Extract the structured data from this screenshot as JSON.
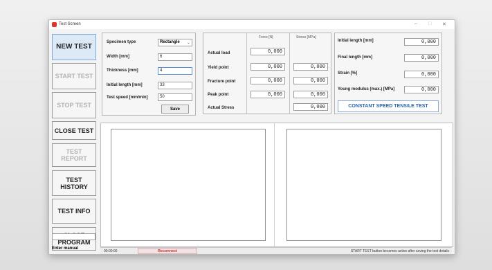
{
  "window": {
    "title": "Test Screen",
    "minimize": "–",
    "maximize": "□",
    "close": "✕"
  },
  "sidebar": {
    "new_test": "NEW TEST",
    "start_test": "START TEST",
    "stop_test": "STOP TEST",
    "close_test": "CLOSE TEST",
    "test_report": "TEST REPORT",
    "test_history": "TEST HISTORY",
    "test_info": "TEST INFO",
    "close_program": "CLOSE PROGRAM",
    "manual_value": "",
    "enter_manual": "Enter manual"
  },
  "specimen": {
    "type_label": "Specimen type",
    "type_value": "Rectangle",
    "width_label": "Width [mm]",
    "width_value": "6",
    "thickness_label": "Thickness [mm]",
    "thickness_value": "4",
    "initial_length_label": "Initial length [mm]",
    "initial_length_value": "33",
    "speed_label": "Test speed [mm/min]",
    "speed_value": "50",
    "save_label": "Save"
  },
  "results": {
    "force_header": "Force [N]",
    "stress_header": "Stress [MPa]",
    "actual_load_label": "Actual load",
    "actual_load_force": "0,000",
    "yield_label": "Yield point",
    "yield_force": "0,000",
    "yield_stress": "0,000",
    "fracture_label": "Fracture point",
    "fracture_force": "0,000",
    "fracture_stress": "0,000",
    "peak_label": "Peak point",
    "peak_force": "0,000",
    "peak_stress": "0,000",
    "actual_stress_label": "Actual Stress",
    "actual_stress_value": "0,000"
  },
  "lengths": {
    "initial_length_label": "Initial length [mm]",
    "initial_length_value": "0,000",
    "final_length_label": "Final length [mm]",
    "final_length_value": "0,000",
    "strain_label": "Strain [%]",
    "strain_value": "0,000",
    "young_label": "Young modulus (max.) [MPa]",
    "young_value": "0,000",
    "mode_label": "CONSTANT SPEED TENSILE TEST"
  },
  "status": {
    "time": "00:00:00",
    "reconnect": "Reconnect",
    "message": "START TEST button becomes active after saving the test details"
  },
  "colors": {
    "accent": "#2a63a6",
    "reconnect": "#c73333",
    "active_button": "#dce9f7"
  }
}
